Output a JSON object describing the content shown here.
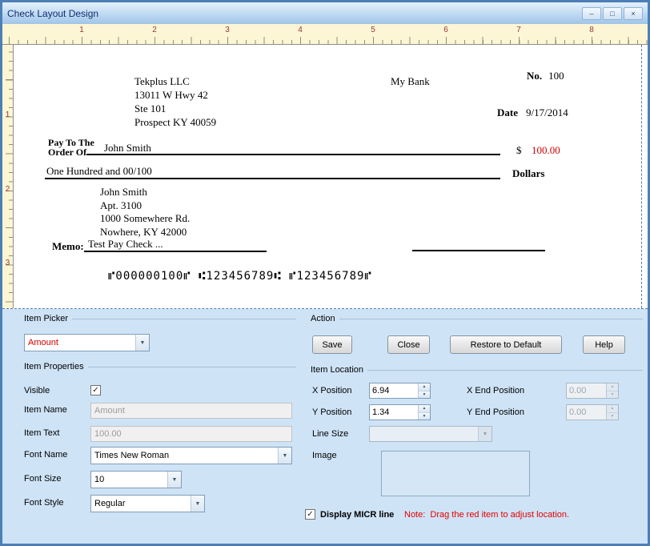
{
  "window": {
    "title": "Check Layout Design"
  },
  "icons": {
    "minimize": "–",
    "maximize": "□",
    "close": "×",
    "dropdown": "▼",
    "spin_up": "▲",
    "spin_down": "▼",
    "check": "✓"
  },
  "ruler": {
    "horizontal": [
      "1",
      "2",
      "3",
      "4",
      "5",
      "6",
      "7",
      "8"
    ],
    "vertical": [
      "1",
      "2",
      "3"
    ]
  },
  "check": {
    "payer_lines": [
      "Tekplus LLC",
      "13011 W Hwy 42",
      "Ste 101",
      "Prospect KY 40059"
    ],
    "bank_name": "My Bank",
    "number_label": "No.",
    "number_value": "100",
    "date_label": "Date",
    "date_value": "9/17/2014",
    "pay_to_line1": "Pay To The",
    "pay_to_line2": "Order Of",
    "payee_name": "John Smith",
    "currency_symbol": "$",
    "amount_value": "100.00",
    "amount_words": "One Hundred  and 00/100",
    "dollars_label": "Dollars",
    "payee_address": [
      "John Smith",
      "Apt. 3100",
      "1000 Somewhere Rd.",
      "Nowhere, KY 42000"
    ],
    "memo_label": "Memo:",
    "memo_text": "Test Pay Check ...",
    "micr_line": "⑈000000100⑈  ⑆123456789⑆ ⑈123456789⑈"
  },
  "item_picker": {
    "title": "Item Picker",
    "value": "Amount"
  },
  "item_properties": {
    "title": "Item Properties",
    "visible_label": "Visible",
    "item_name_label": "Item Name",
    "item_name_value": "Amount",
    "item_text_label": "Item Text",
    "item_text_value": "100.00",
    "font_name_label": "Font Name",
    "font_name_value": "Times New Roman",
    "font_size_label": "Font Size",
    "font_size_value": "10",
    "font_style_label": "Font Style",
    "font_style_value": "Regular"
  },
  "action": {
    "title": "Action",
    "save": "Save",
    "close": "Close",
    "restore": "Restore to Default",
    "help": "Help"
  },
  "item_location": {
    "title": "Item Location",
    "x_position_label": "X Position",
    "x_position_value": "6.94",
    "x_end_label": "X End Position",
    "x_end_value": "0.00",
    "y_position_label": "Y Position",
    "y_position_value": "1.34",
    "y_end_label": "Y End Position",
    "y_end_value": "0.00",
    "line_size_label": "Line Size",
    "image_label": "Image"
  },
  "footer": {
    "micr_checkbox_label": "Display MICR line",
    "note": "Note:  Drag the red item to adjust location."
  },
  "colors": {
    "accent_red": "#d40000",
    "panel_blue": "#cee3f6",
    "ruler_cream": "#fcf6d4",
    "window_border": "#4d7fb7"
  }
}
